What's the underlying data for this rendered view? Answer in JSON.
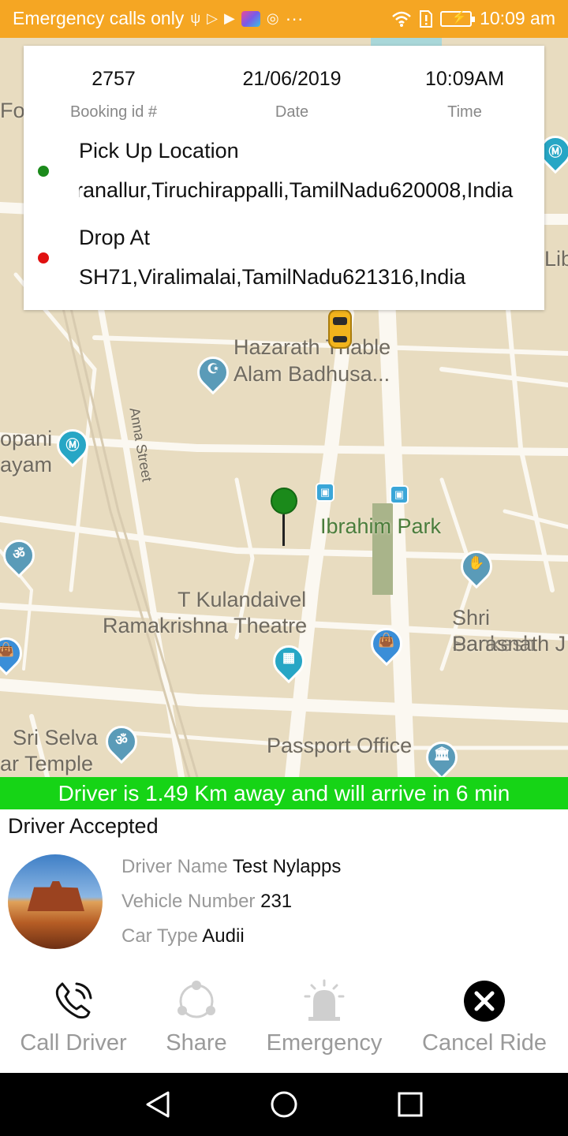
{
  "status_bar": {
    "carrier": "Emergency calls only",
    "time": "10:09 am",
    "more": "···"
  },
  "map": {
    "labels": {
      "hazarath": "Hazarath Thable",
      "alam": "Alam Badhusa...",
      "anna": "Anna Street",
      "ibrahim": "Ibrahim Park",
      "kulandaivel": "T Kulandaivel",
      "ramakrishna": "Ramakrishna Theatre",
      "sankesh": "Shri Sankesh",
      "parasnath": "Parasnath J",
      "selva": "Sri Selva",
      "temple": "ar Temple",
      "passport": "Passport Office",
      "oppani": "opani",
      "ayam": "ayam",
      "for": "For",
      "lib": "Lib"
    }
  },
  "booking": {
    "booking_id": "2757",
    "booking_id_label": "Booking id #",
    "date": "21/06/2019",
    "date_label": "Date",
    "time": "10:09AM",
    "time_label": "Time",
    "pickup_label": "Pick Up Location",
    "pickup_address": "ranallur,Tiruchirappalli,TamilNadu620008,India",
    "drop_label": "Drop At",
    "drop_address": "SH71,Viralimalai,TamilNadu621316,India",
    "pickup_color": "#1b8a1b",
    "drop_color": "#e01010"
  },
  "arrival_banner": "Driver is 1.49 Km away and will arrive in 6 min",
  "driver": {
    "status": "Driver Accepted",
    "name_label": "Driver Name",
    "name": "Test Nylapps",
    "vehicle_label": "Vehicle Number",
    "vehicle": "231",
    "car_type_label": "Car Type",
    "car_type": "Audii"
  },
  "actions": {
    "call": "Call Driver",
    "share": "Share",
    "emergency": "Emergency",
    "cancel": "Cancel Ride"
  },
  "colors": {
    "status_bar": "#f5a623",
    "banner": "#16d416"
  }
}
